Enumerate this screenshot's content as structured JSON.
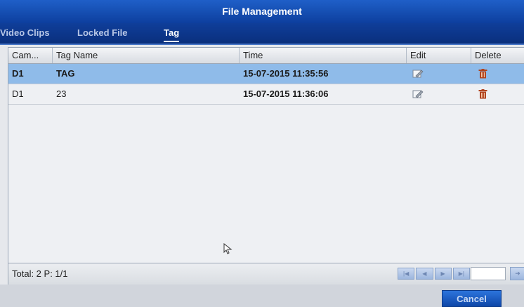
{
  "window": {
    "title": "File Management"
  },
  "tabs": [
    {
      "label": "Video Clips",
      "active": false
    },
    {
      "label": "Locked File",
      "active": false
    },
    {
      "label": "Tag",
      "active": true
    }
  ],
  "table": {
    "columns": [
      "Cam...",
      "Tag Name",
      "Time",
      "Edit",
      "Delete"
    ],
    "rows": [
      {
        "camera": "D1",
        "tag_name": "TAG",
        "time": "15-07-2015 11:35:56",
        "edit_icon": "pencil-icon",
        "delete_icon": "trash-icon",
        "selected": true
      },
      {
        "camera": "D1",
        "tag_name": "23",
        "time": "15-07-2015 11:36:06",
        "edit_icon": "pencil-icon",
        "delete_icon": "trash-icon",
        "selected": false
      }
    ]
  },
  "footer": {
    "total_text": "Total: 2 P: 1/1",
    "pager_icons": [
      "first-page-icon",
      "previous-page-icon",
      "next-page-icon",
      "last-page-icon"
    ],
    "page_input_value": "",
    "go_icon": "go-arrow-icon"
  },
  "buttons": {
    "cancel_label": "Cancel"
  },
  "colors": {
    "title_bar": "#1f5fc8",
    "selected_row": "#8fbbe9",
    "delete_icon": "#b0441f"
  }
}
